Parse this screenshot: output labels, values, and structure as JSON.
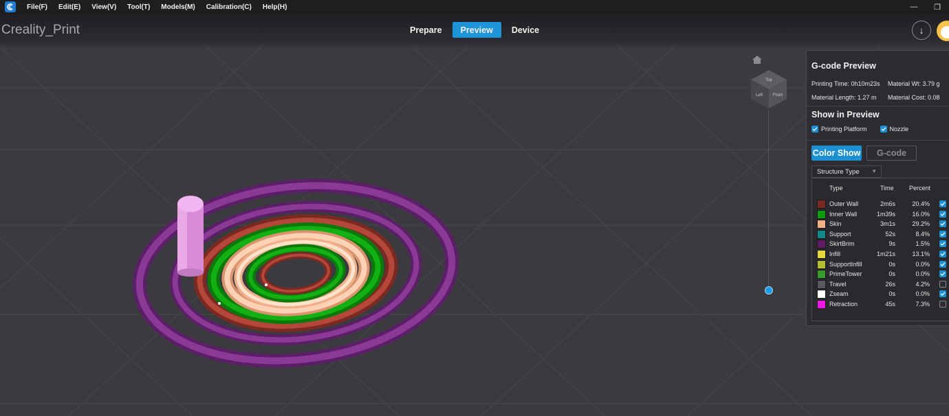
{
  "menubar": {
    "items": [
      "File(F)",
      "Edit(E)",
      "View(V)",
      "Tool(T)",
      "Models(M)",
      "Calibration(C)",
      "Help(H)"
    ]
  },
  "titlebar": {
    "app_title": "Creality_Print",
    "tabs": [
      {
        "label": "Prepare",
        "active": false
      },
      {
        "label": "Preview",
        "active": true
      },
      {
        "label": "Device",
        "active": false
      }
    ]
  },
  "panel": {
    "title": "G-code Preview",
    "stats": {
      "printing_time": "Printing Time: 0h10m23s",
      "material_wt": "Material Wt: 3.79 g",
      "material_length": "Material Length: 1.27 m",
      "material_cost": "Material Cost: 0.08"
    },
    "show_title": "Show in Preview",
    "printing_platform": "Printing Platform",
    "nozzle": "Nozzle",
    "color_show": "Color Show",
    "gcode": "G-code",
    "structure_type": "Structure Type",
    "headers": {
      "type": "Type",
      "time": "Time",
      "percent": "Percent"
    },
    "rows": [
      {
        "type": "Outer Wall",
        "time": "2m6s",
        "percent": "20.4%",
        "color": "#7a2a22",
        "checked": true
      },
      {
        "type": "Inner Wall",
        "time": "1m39s",
        "percent": "16.0%",
        "color": "#0e9a0e",
        "checked": true
      },
      {
        "type": "Skin",
        "time": "3m1s",
        "percent": "29.2%",
        "color": "#f2b08a",
        "checked": true
      },
      {
        "type": "Support",
        "time": "52s",
        "percent": "8.4%",
        "color": "#118a8c",
        "checked": true
      },
      {
        "type": "SkirtBrim",
        "time": "9s",
        "percent": "1.5%",
        "color": "#5e1d66",
        "checked": true
      },
      {
        "type": "Infill",
        "time": "1m21s",
        "percent": "13.1%",
        "color": "#e3d93a",
        "checked": true
      },
      {
        "type": "SupportInfill",
        "time": "0s",
        "percent": "0.0%",
        "color": "#b5bd32",
        "checked": true
      },
      {
        "type": "PrimeTower",
        "time": "0s",
        "percent": "0.0%",
        "color": "#3a9a2e",
        "checked": true
      },
      {
        "type": "Travel",
        "time": "26s",
        "percent": "4.2%",
        "color": "#5a5a5e",
        "checked": false
      },
      {
        "type": "Zseam",
        "time": "0s",
        "percent": "0.0%",
        "color": "#ffffff",
        "checked": true
      },
      {
        "type": "Retraction",
        "time": "45s",
        "percent": "7.3%",
        "color": "#f016e8",
        "checked": false
      }
    ]
  },
  "view_cube": {
    "top": "Top",
    "left": "Left",
    "front": "Front"
  },
  "colors": {
    "accent": "#1d93d8",
    "background": "#3b3b3f"
  }
}
